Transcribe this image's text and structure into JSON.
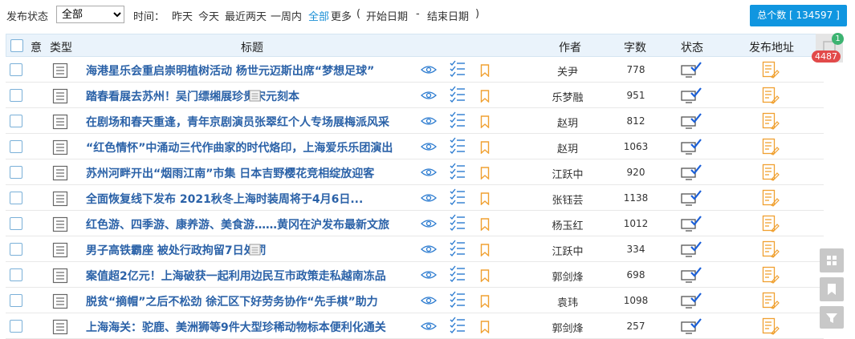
{
  "filter": {
    "status_label": "发布状态",
    "status_value": "全部",
    "time_label": "时间：",
    "time_links": [
      "昨天",
      "今天",
      "最近两天",
      "一周内",
      "全部",
      "更多"
    ],
    "range_open": "(",
    "start_date": "开始日期",
    "dash": "-",
    "end_date": "结束日期",
    "range_close": ")",
    "total_label": "总个数 [ 134597 ]"
  },
  "header": {
    "yi": "意",
    "type": "类型",
    "title": "标题",
    "author": "作者",
    "words": "字数",
    "status": "状态",
    "url": "发布地址"
  },
  "side": {
    "notify_count": "1",
    "unread_count": "4487"
  },
  "rows": [
    {
      "title": "海港星乐会重启崇明植树活动 杨世元迈斯出席“梦想足球”",
      "author": "关尹",
      "words": "778",
      "doc": false
    },
    {
      "title": "踏春看展去苏州！吴门缥缃展珍贵宋元刻本",
      "author": "乐梦融",
      "words": "951",
      "doc": true
    },
    {
      "title": "在剧场和春天重逢，青年京剧演员张翠红个人专场展梅派风采",
      "author": "赵玥",
      "words": "812",
      "doc": false
    },
    {
      "title": "“红色情怀”中涌动三代作曲家的时代烙印，上海爱乐乐团演出",
      "author": "赵玥",
      "words": "1063",
      "doc": false
    },
    {
      "title": "苏州河畔开出“烟雨江南”市集 日本吉野樱花竞相绽放迎客",
      "author": "江跃中",
      "words": "920",
      "doc": false
    },
    {
      "title": "全面恢复线下发布 2021秋冬上海时装周将于4月6日...",
      "author": "张钰芸",
      "words": "1138",
      "doc": false
    },
    {
      "title": "红色游、四季游、康养游、美食游……黄冈在沪发布最新文旅",
      "author": "杨玉红",
      "words": "1012",
      "doc": false
    },
    {
      "title": "男子高铁霸座 被处行政拘留7日处罚",
      "author": "江跃中",
      "words": "334",
      "doc": true
    },
    {
      "title": "案值超2亿元！上海破获一起利用边民互市政策走私越南冻品",
      "author": "郭剑烽",
      "words": "698",
      "doc": false
    },
    {
      "title": "脱贫“摘帽”之后不松劲 徐汇区下好劳务协作“先手棋”助力",
      "author": "袁玮",
      "words": "1098",
      "doc": false
    },
    {
      "title": "上海海关：驼鹿、美洲狮等9件大型珍稀动物标本便利化通关",
      "author": "郭剑烽",
      "words": "257",
      "doc": false
    }
  ]
}
